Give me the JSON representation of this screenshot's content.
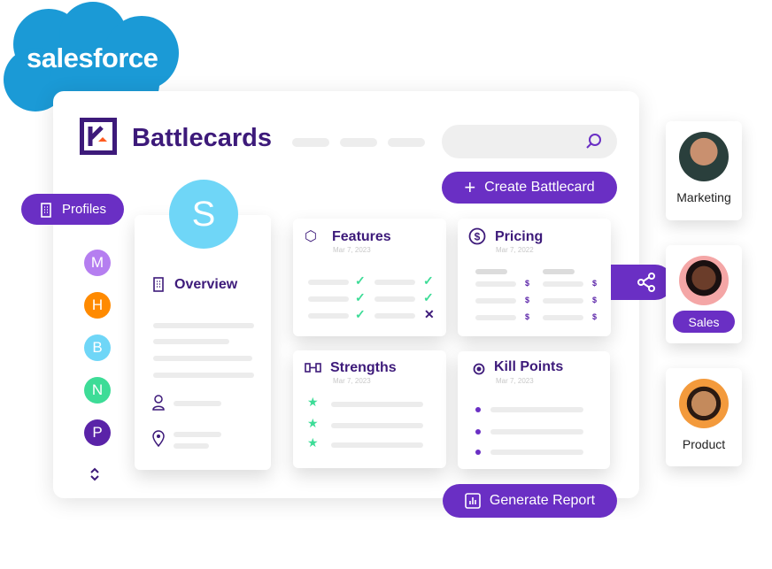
{
  "brand": {
    "salesforce": "salesforce",
    "app_title": "Battlecards"
  },
  "header": {
    "create_label": "Create Battlecard",
    "search_icon": "search-icon"
  },
  "sidebar": {
    "profiles_label": "Profiles",
    "avatars": [
      {
        "letter": "M",
        "color": "#b57ef0"
      },
      {
        "letter": "H",
        "color": "#ff8a00"
      },
      {
        "letter": "B",
        "color": "#6fd6f7"
      },
      {
        "letter": "N",
        "color": "#3ddc97"
      },
      {
        "letter": "P",
        "color": "#5a23a8"
      }
    ]
  },
  "overview": {
    "avatar_letter": "S",
    "title": "Overview"
  },
  "cards": {
    "features": {
      "title": "Features",
      "date": "Mar 7, 2023"
    },
    "pricing": {
      "title": "Pricing",
      "date": "Mar 7, 2022"
    },
    "strengths": {
      "title": "Strengths",
      "date": "Mar 7, 2023"
    },
    "kill_points": {
      "title": "Kill Points",
      "date": "Mar 7, 2023"
    }
  },
  "footer": {
    "report_label": "Generate Report"
  },
  "people": [
    {
      "label": "Marketing"
    },
    {
      "label": "Sales"
    },
    {
      "label": "Product"
    }
  ],
  "colors": {
    "accent": "#6a2fc4",
    "title": "#3d1a7a",
    "salesforce": "#1b9ad6",
    "green": "#3ddc97"
  }
}
